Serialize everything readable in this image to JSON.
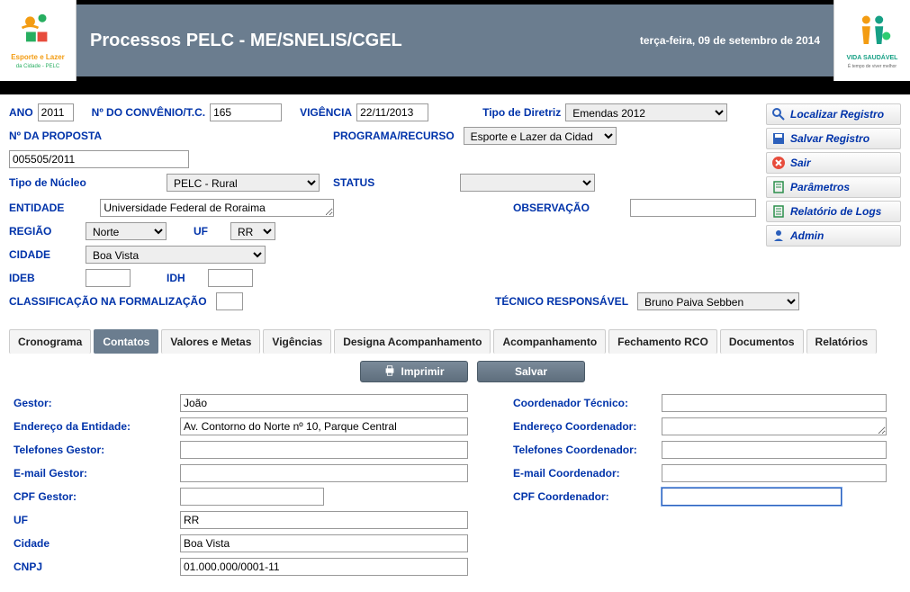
{
  "header": {
    "title": "Processos PELC - ME/SNELIS/CGEL",
    "date": "terça-feira, 09 de setembro de 2014",
    "logo_left_line1": "Esporte e Lazer",
    "logo_left_line2": "da Cidade - PELC",
    "logo_right_line1": "VIDA SAUDÁVEL",
    "logo_right_line2": "É tempo de viver melhor"
  },
  "form": {
    "ano_label": "ANO",
    "ano_value": "2011",
    "convenio_label": "Nº DO CONVÊNIO/T.C.",
    "convenio_value": "165",
    "vigencia_label": "VIGÊNCIA",
    "vigencia_value": "22/11/2013",
    "tipo_diretriz_label": "Tipo de Diretriz",
    "tipo_diretriz_value": "Emendas 2012",
    "proposta_label": "Nº DA PROPOSTA",
    "proposta_value": "005505/2011",
    "programa_label": "PROGRAMA/RECURSO",
    "programa_value": "Esporte e Lazer da Cidad",
    "tipo_nucleo_label": "Tipo de Núcleo",
    "tipo_nucleo_value": "PELC - Rural",
    "status_label": "STATUS",
    "status_value": "",
    "entidade_label": "ENTIDADE",
    "entidade_value": "Universidade Federal de Roraima",
    "observacao_label": "OBSERVAÇÃO",
    "observacao_value": "",
    "regiao_label": "REGIÃO",
    "regiao_value": "Norte",
    "uf_label": "UF",
    "uf_value": "RR",
    "cidade_label": "CIDADE",
    "cidade_value": "Boa Vista",
    "ideb_label": "IDEB",
    "ideb_value": "",
    "idh_label": "IDH",
    "idh_value": "",
    "classificacao_label": "CLASSIFICAÇÃO NA FORMALIZAÇÃO",
    "classificacao_value": "",
    "tecnico_label": "TÉCNICO RESPONSÁVEL",
    "tecnico_value": "Bruno Paiva Sebben"
  },
  "sidebar": {
    "localizar": "Localizar Registro",
    "salvar": "Salvar Registro",
    "sair": "Sair",
    "parametros": "Parâmetros",
    "logs": "Relatório de Logs",
    "admin": "Admin"
  },
  "tabs": {
    "cronograma": "Cronograma",
    "contatos": "Contatos",
    "valores": "Valores e Metas",
    "vigencias": "Vigências",
    "designa": "Designa Acompanhamento",
    "acompanhamento": "Acompanhamento",
    "fechamento": "Fechamento RCO",
    "documentos": "Documentos",
    "relatorios": "Relatórios"
  },
  "actions": {
    "imprimir": "Imprimir",
    "salvar": "Salvar"
  },
  "contatos": {
    "gestor_label": "Gestor:",
    "gestor_value": "João",
    "coord_tecnico_label": "Coordenador Técnico:",
    "coord_tecnico_value": "",
    "endereco_ent_label": "Endereço da Entidade:",
    "endereco_ent_value": "Av. Contorno do Norte nº 10, Parque Central",
    "endereco_coord_label": "Endereço Coordenador:",
    "endereco_coord_value": "",
    "tel_gestor_label": "Telefones Gestor:",
    "tel_gestor_value": "",
    "tel_coord_label": "Telefones Coordenador:",
    "tel_coord_value": "",
    "email_gestor_label": "E-mail Gestor:",
    "email_gestor_value": "",
    "email_coord_label": "E-mail Coordenador:",
    "email_coord_value": "",
    "cpf_gestor_label": "CPF Gestor:",
    "cpf_gestor_value": "",
    "cpf_coord_label": "CPF Coordenador:",
    "cpf_coord_value": "",
    "uf_label": "UF",
    "uf_value": "RR",
    "cidade_label": "Cidade",
    "cidade_value": "Boa Vista",
    "cnpj_label": "CNPJ",
    "cnpj_value": "01.000.000/0001-11"
  }
}
